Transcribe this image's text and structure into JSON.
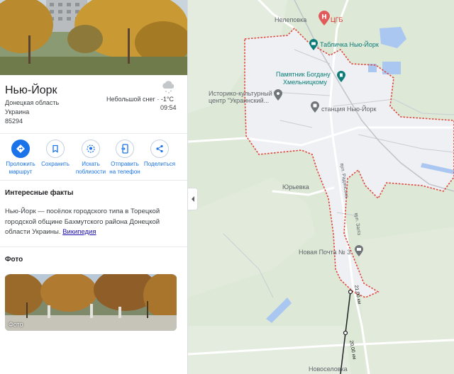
{
  "place": {
    "title": "Нью-Йорк",
    "region": "Донецкая область",
    "country": "Украина",
    "zip": "85294"
  },
  "weather": {
    "condition": "Небольшой снег · -1°C",
    "time": "09:54",
    "icon": "cloud-snow-icon"
  },
  "actions": [
    {
      "icon": "directions-icon",
      "label": "Проложить маршрут"
    },
    {
      "icon": "bookmark-icon",
      "label": "Сохранить"
    },
    {
      "icon": "nearby-icon",
      "label": "Искать поблизости"
    },
    {
      "icon": "send-to-phone-icon",
      "label": "Отправить на телефон"
    },
    {
      "icon": "share-icon",
      "label": "Поделиться"
    }
  ],
  "facts": {
    "title": "Интересные факты",
    "text": "Нью-Йорк — посёлок городского типа в Торецкой городской общине Бахмутского района Донецкой области Украины.",
    "link": "Википедия"
  },
  "photos": {
    "title": "Фото",
    "label": "Фото"
  },
  "map": {
    "labels": {
      "nelepovka": "Нелеповка",
      "tsgb": "ЦГБ",
      "tablichka": "Табличка Нью-Йорк",
      "pamyatnik_1": "Памятник Богдану",
      "pamyatnik_2": "Хмельницкому",
      "centr_1": "Историко-культурный",
      "centr_2": "центр \"Украинский...",
      "station": "станция Нью-Йорк",
      "yurievka": "Юрьевка",
      "novaya_pochta": "Новая Почта № 3",
      "novoselovka": "Новоселовка",
      "street_1": "вул. Радянська",
      "street_2": "вул. Заліз",
      "measure_1": "21,00 км",
      "measure_2": "20,00 км"
    },
    "colors": {
      "boundary": "#e0463a",
      "pin_teal": "#0b7c77",
      "pin_gray": "#70757a",
      "pin_red": "#e25b5b",
      "water": "#aac7f2"
    }
  }
}
